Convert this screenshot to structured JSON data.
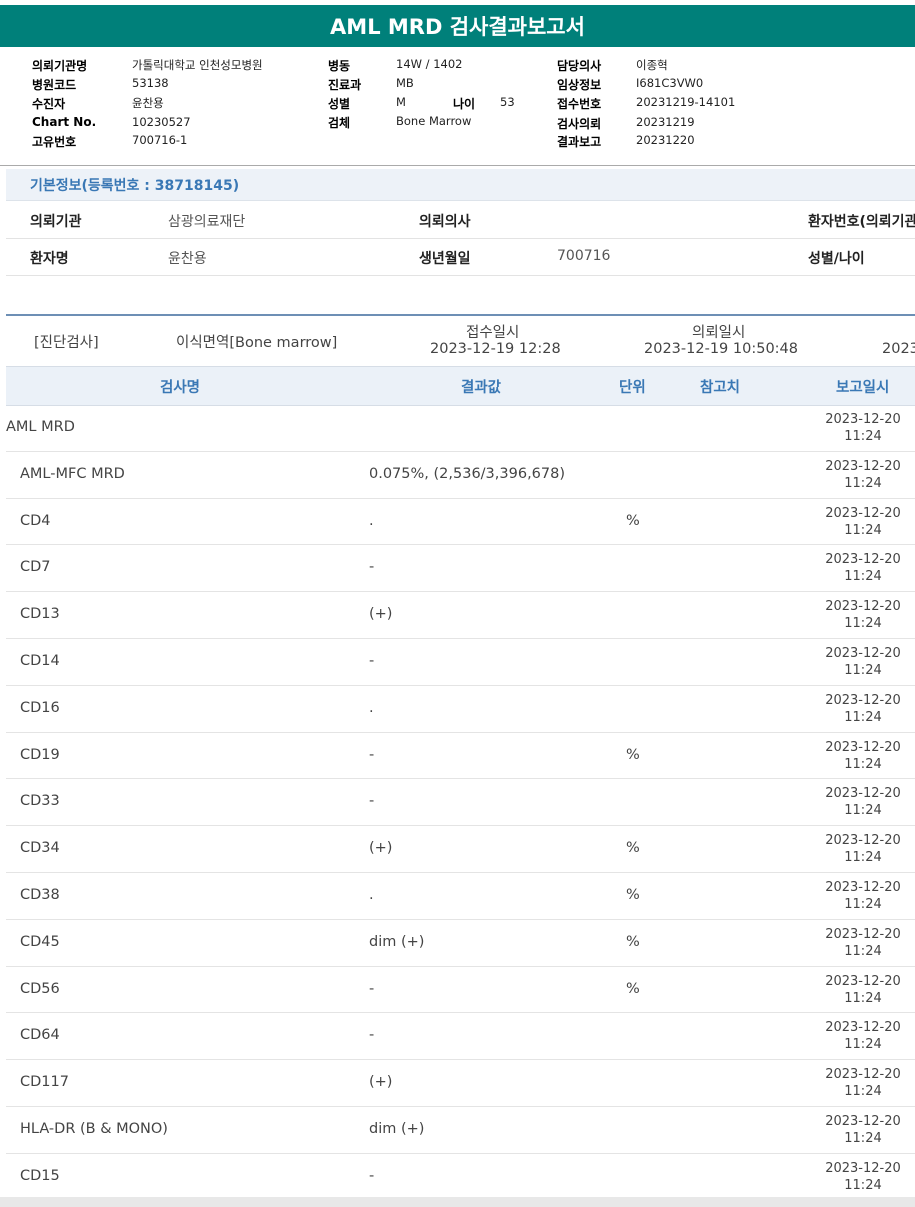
{
  "title": "AML MRD 검사결과보고서",
  "header": {
    "col1": [
      {
        "label": "의뢰기관명",
        "value": "가톨릭대학교 인천성모병원"
      },
      {
        "label": "병원코드",
        "value": "53138"
      },
      {
        "label": "수진자",
        "value": "윤찬용"
      },
      {
        "label": "Chart No.",
        "value": "10230527"
      },
      {
        "label": "고유번호",
        "value": "700716-1"
      }
    ],
    "col2": [
      {
        "label": "병동",
        "value": "14W / 1402"
      },
      {
        "label": "진료과",
        "value": "MB"
      },
      {
        "label": "성별",
        "value": "M"
      },
      {
        "label": "검체",
        "value": "Bone Marrow"
      }
    ],
    "age_label": "나이",
    "age_value": "53",
    "col3": [
      {
        "label": "담당의사",
        "value": "이종혁"
      },
      {
        "label": "임상정보",
        "value": "I681C3VW0"
      },
      {
        "label": "접수번호",
        "value": "20231219-14101"
      },
      {
        "label": "검사의뢰",
        "value": "20231219"
      },
      {
        "label": "결과보고",
        "value": "20231220"
      }
    ]
  },
  "basic_info": {
    "heading": "기본정보(등록번호 : 38718145)",
    "institution_label": "의뢰기관",
    "institution_value": "삼광의료재단",
    "doctor_label": "의뢰의사",
    "patient_no_label": "환자번호(의뢰기관",
    "patient_name_label": "환자명",
    "patient_name_value": "윤찬용",
    "birth_label": "생년월일",
    "birth_value": "700716",
    "sex_age_label": "성별/나이"
  },
  "specimen": {
    "category": "[진단검사]",
    "specimen_name": "이식면역[Bone marrow]",
    "received_label": "접수일시",
    "received_value": "2023-12-19 12:28",
    "requested_label": "의뢰일시",
    "requested_value": "2023-12-19 10:50:48",
    "next_value": "2023"
  },
  "grid": {
    "headers": {
      "name": "검사명",
      "result": "결과값",
      "unit": "단위",
      "reference": "참고치",
      "report_date": "보고일시"
    },
    "rows": [
      {
        "name": "AML MRD",
        "result": "",
        "unit": "",
        "date": "2023-12-20 11:24",
        "indent": false
      },
      {
        "name": "AML-MFC MRD",
        "result": "0.075%, (2,536/3,396,678)",
        "unit": "",
        "date": "2023-12-20 11:24",
        "indent": true
      },
      {
        "name": "CD4",
        "result": ".",
        "unit": "%",
        "date": "2023-12-20 11:24",
        "indent": true
      },
      {
        "name": "CD7",
        "result": "-",
        "unit": "",
        "date": "2023-12-20 11:24",
        "indent": true
      },
      {
        "name": "CD13",
        "result": "(+)",
        "unit": "",
        "date": "2023-12-20 11:24",
        "indent": true
      },
      {
        "name": "CD14",
        "result": "-",
        "unit": "",
        "date": "2023-12-20 11:24",
        "indent": true
      },
      {
        "name": "CD16",
        "result": ".",
        "unit": "",
        "date": "2023-12-20 11:24",
        "indent": true
      },
      {
        "name": "CD19",
        "result": "-",
        "unit": "%",
        "date": "2023-12-20 11:24",
        "indent": true
      },
      {
        "name": "CD33",
        "result": "-",
        "unit": "",
        "date": "2023-12-20 11:24",
        "indent": true
      },
      {
        "name": "CD34",
        "result": "(+)",
        "unit": "%",
        "date": "2023-12-20 11:24",
        "indent": true
      },
      {
        "name": "CD38",
        "result": ".",
        "unit": "%",
        "date": "2023-12-20 11:24",
        "indent": true
      },
      {
        "name": "CD45",
        "result": "dim (+)",
        "unit": "%",
        "date": "2023-12-20 11:24",
        "indent": true
      },
      {
        "name": "CD56",
        "result": "-",
        "unit": "%",
        "date": "2023-12-20 11:24",
        "indent": true
      },
      {
        "name": "CD64",
        "result": "-",
        "unit": "",
        "date": "2023-12-20 11:24",
        "indent": true
      },
      {
        "name": "CD117",
        "result": "(+)",
        "unit": "",
        "date": "2023-12-20 11:24",
        "indent": true
      },
      {
        "name": "HLA-DR (B & MONO)",
        "result": "dim (+)",
        "unit": "",
        "date": "2023-12-20 11:24",
        "indent": true
      },
      {
        "name": "CD15",
        "result": "-",
        "unit": "",
        "date": "2023-12-20 11:24",
        "indent": true
      }
    ]
  }
}
